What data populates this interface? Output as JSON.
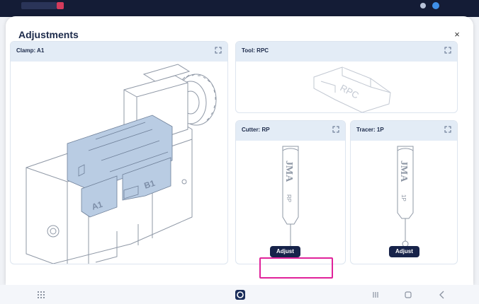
{
  "modal": {
    "title": "Adjustments",
    "close_glyph": "×"
  },
  "cards": {
    "clamp": {
      "title": "Clamp: A1",
      "labels": {
        "left": "A1",
        "right": "B1"
      }
    },
    "tool": {
      "title": "Tool: RPC",
      "engraving": "RPC"
    },
    "cutter": {
      "title": "Cutter: RP",
      "brand": "JMA",
      "code": "RP",
      "button": "Adjust"
    },
    "tracer": {
      "title": "Tracer: 1P",
      "brand": "JMA",
      "code": "1P",
      "button": "Adjust"
    }
  },
  "icons": {
    "expand": "expand-icon",
    "close": "close-icon",
    "app_grid": "app-grid-icon",
    "app_logo": "app-logo-icon",
    "recents": "recents-icon",
    "home": "home-icon",
    "back": "back-icon"
  },
  "colors": {
    "accent_dark": "#17234a",
    "card_header": "#e3ecf6",
    "highlight": "#e0229a",
    "clamp_jaw": "#b9cce3"
  }
}
